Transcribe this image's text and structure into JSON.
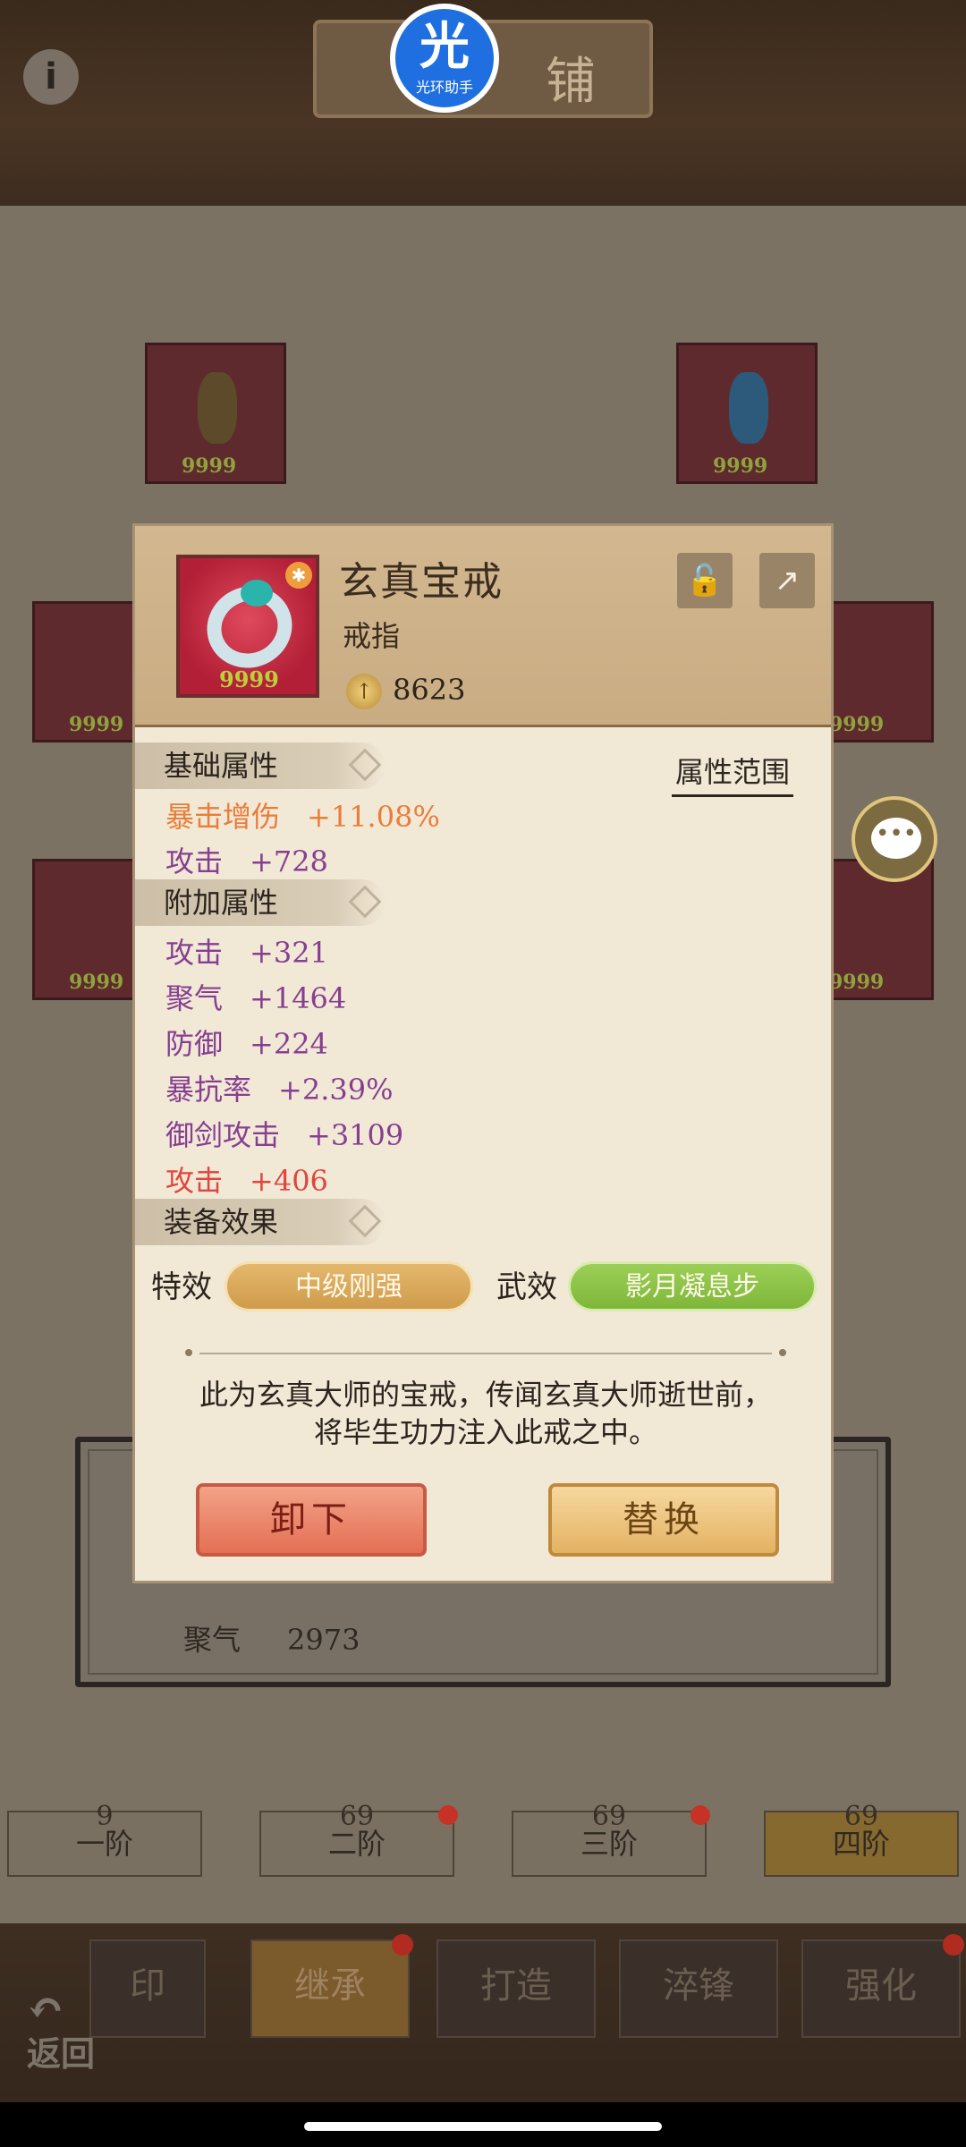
{
  "header": {
    "shop_title": "铺",
    "info_icon": "i"
  },
  "overlay": {
    "halo_big": "光",
    "halo_small": "光环助手"
  },
  "equipment_slots": [
    {
      "count": "9999"
    },
    {
      "count": "9999"
    },
    {
      "count": "9999"
    },
    {
      "count": "9999"
    },
    {
      "count": "9999"
    },
    {
      "count": "9999"
    }
  ],
  "background_panel": {
    "stat_label": "聚气",
    "stat_value": "2973"
  },
  "tiers": [
    {
      "label": "一阶",
      "marks": "9"
    },
    {
      "label": "二阶",
      "marks": "69"
    },
    {
      "label": "三阶",
      "marks": "69"
    },
    {
      "label": "四阶",
      "marks": "69"
    }
  ],
  "tabs": [
    {
      "label": "印"
    },
    {
      "label": "继承"
    },
    {
      "label": "打造"
    },
    {
      "label": "淬锋"
    },
    {
      "label": "强化"
    }
  ],
  "back_label": "返回",
  "popup": {
    "item_name": "玄真宝戒",
    "item_type": "戒指",
    "item_count": "9999",
    "power": "8623",
    "base_section": "基础属性",
    "range_button": "属性范围",
    "base_attrs": [
      {
        "name": "暴击增伤",
        "value": "+11.08%"
      },
      {
        "name": "攻击",
        "value": "+728"
      }
    ],
    "extra_section": "附加属性",
    "extra_attrs": [
      {
        "name": "攻击",
        "value": "+321"
      },
      {
        "name": "聚气",
        "value": "+1464"
      },
      {
        "name": "防御",
        "value": "+224"
      },
      {
        "name": "暴抗率",
        "value": "+2.39%"
      },
      {
        "name": "御剑攻击",
        "value": "+3109"
      },
      {
        "name": "攻击",
        "value": "+406"
      }
    ],
    "effect_section": "装备效果",
    "special_label": "特效",
    "special_value": "中级刚强",
    "martial_label": "武效",
    "martial_value": "影月凝息步",
    "description": "此为玄真大师的宝戒，传闻玄真大师逝世前，将毕生功力注入此戒之中。",
    "unequip_label": "卸下",
    "replace_label": "替换"
  },
  "colors": {
    "attr_purple": "#863f90",
    "attr_orange": "#e97d3a",
    "attr_red": "#e0463d",
    "effect_gold": "#d9a85a",
    "effect_green": "#8cc348"
  },
  "icons": {
    "lock": "unlock-icon",
    "share": "share-icon",
    "chat": "chat-icon",
    "power": "power-icon"
  }
}
